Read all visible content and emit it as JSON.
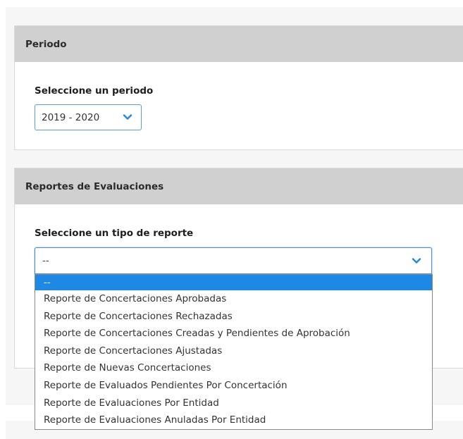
{
  "periodo_card": {
    "title": "Periodo",
    "field_label": "Seleccione un periodo",
    "selected_period": "2019 - 2020"
  },
  "reportes_card": {
    "title": "Reportes de Evaluaciones",
    "field_label": "Seleccione un tipo de reporte",
    "selected_value": "--",
    "options": [
      "--",
      "Reporte de Concertaciones Aprobadas",
      "Reporte de Concertaciones Rechazadas",
      "Reporte de Concertaciones Creadas y Pendientes de Aprobación",
      "Reporte de Concertaciones Ajustadas",
      "Reporte de Nuevas Concertaciones",
      "Reporte de Evaluados Pendientes Por Concertación",
      "Reporte de Evaluaciones Por Entidad",
      "Reporte de Evaluaciones Anuladas Por Entidad"
    ]
  },
  "icons": {
    "select_chevron": "chevron-down-icon"
  },
  "colors": {
    "header_bg": "#d0d0d0",
    "select_border": "#4a90d9",
    "option_highlight": "#1e88e5",
    "chevron": "#1e88e5"
  }
}
